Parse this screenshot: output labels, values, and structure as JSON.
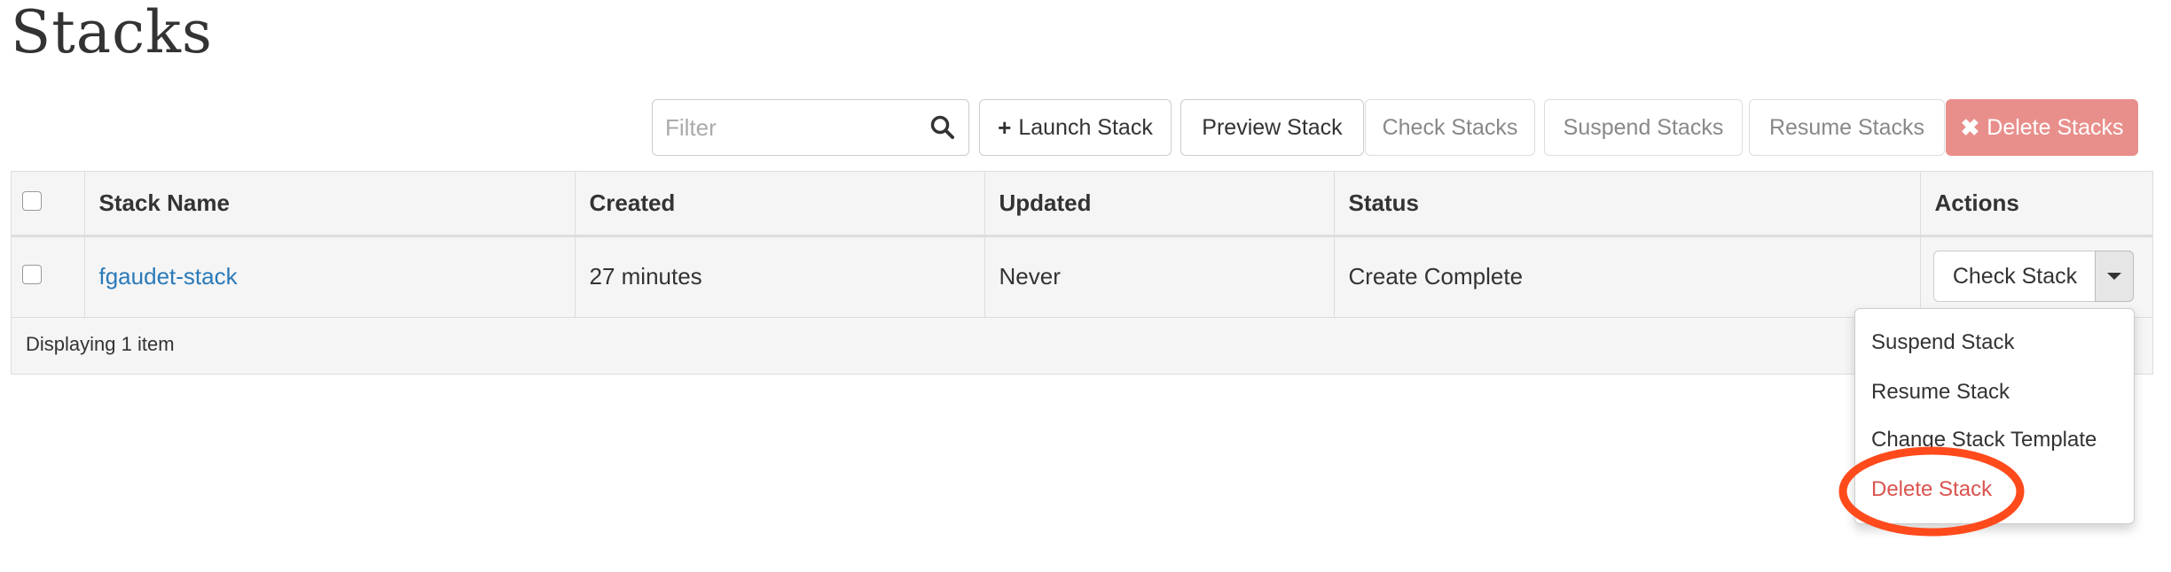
{
  "page": {
    "title": "Stacks"
  },
  "toolbar": {
    "filter_placeholder": "Filter",
    "launch_label": "Launch Stack",
    "preview_label": "Preview Stack",
    "check_label": "Check Stacks",
    "suspend_label": "Suspend Stacks",
    "resume_label": "Resume Stacks",
    "delete_label": "Delete Stacks"
  },
  "table": {
    "columns": [
      "Stack Name",
      "Created",
      "Updated",
      "Status",
      "Actions"
    ],
    "rows": [
      {
        "name": "fgaudet-stack",
        "created": "27 minutes",
        "updated": "Never",
        "status": "Create Complete",
        "action": "Check Stack"
      }
    ],
    "footer": "Displaying 1 item"
  },
  "actions_menu": {
    "items": [
      "Suspend Stack",
      "Resume Stack",
      "Change Stack Template",
      "Delete Stack"
    ],
    "highlighted_item": "Delete Stack"
  },
  "colors": {
    "link": "#2a7ab9",
    "danger": "#d9534f",
    "danger_button_bg": "#e88f8c",
    "annotation_circle": "#ff4a1c"
  },
  "icons": {
    "search": "search-icon",
    "plus": "plus-icon",
    "times": "times-icon",
    "caret": "caret-down-icon"
  }
}
